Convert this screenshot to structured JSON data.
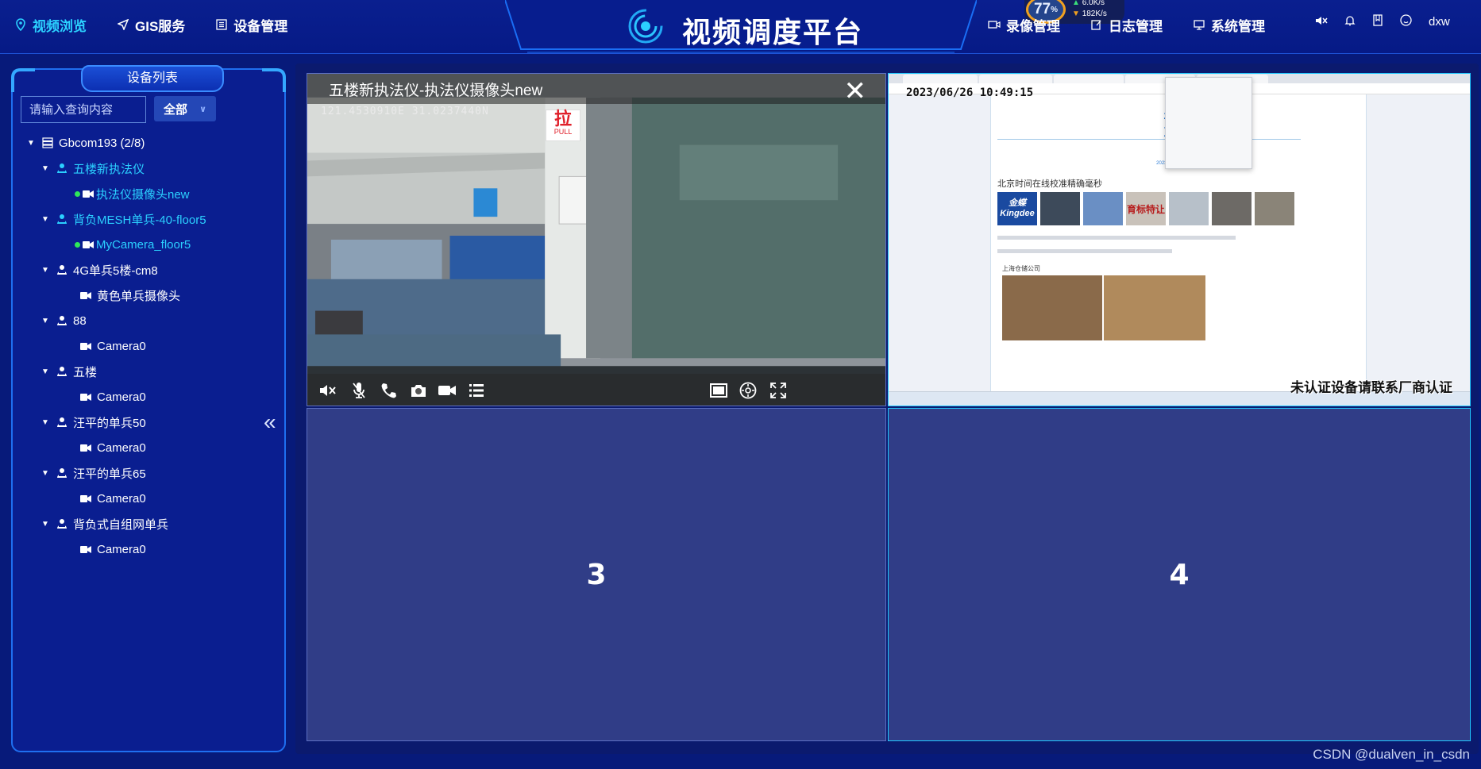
{
  "header": {
    "title": "视频调度平台",
    "nav_left": [
      {
        "label": "视频浏览",
        "icon": "location-pin-icon",
        "active": true
      },
      {
        "label": "GIS服务",
        "icon": "navigation-arrow-icon",
        "active": false
      },
      {
        "label": "设备管理",
        "icon": "list-icon",
        "active": false
      }
    ],
    "nav_right": [
      {
        "label": "录像管理",
        "icon": "video-camera-icon"
      },
      {
        "label": "日志管理",
        "icon": "document-edit-icon"
      },
      {
        "label": "系统管理",
        "icon": "monitor-icon"
      }
    ],
    "username": "dxw",
    "net_meter": {
      "percent": "77",
      "percent_unit": "%",
      "upload": "6.0K/s",
      "download": "182K/s"
    }
  },
  "sidebar": {
    "title": "设备列表",
    "search_placeholder": "请输入查询内容",
    "filter_value": "全部",
    "tree": [
      {
        "label": "Gbcom193 (2/8)",
        "level": 0,
        "type": "server",
        "expanded": true
      },
      {
        "label": "五楼新执法仪",
        "level": 1,
        "type": "device-online",
        "expanded": true,
        "selected": true
      },
      {
        "label": "执法仪摄像头new",
        "level": 2,
        "type": "camera",
        "online": true,
        "selected": true
      },
      {
        "label": "背负MESH单兵-40-floor5",
        "level": 1,
        "type": "device-online",
        "expanded": true,
        "selected": true
      },
      {
        "label": "MyCamera_floor5",
        "level": 2,
        "type": "camera",
        "online": true,
        "selected": true
      },
      {
        "label": "4G单兵5楼-cm8",
        "level": 1,
        "type": "device",
        "expanded": true
      },
      {
        "label": "黄色单兵摄像头",
        "level": 2,
        "type": "camera"
      },
      {
        "label": "88",
        "level": 1,
        "type": "device",
        "expanded": true
      },
      {
        "label": "Camera0",
        "level": 2,
        "type": "camera"
      },
      {
        "label": "五楼",
        "level": 1,
        "type": "device",
        "expanded": true
      },
      {
        "label": "Camera0",
        "level": 2,
        "type": "camera"
      },
      {
        "label": "汪平的单兵50",
        "level": 1,
        "type": "device",
        "expanded": true
      },
      {
        "label": "Camera0",
        "level": 2,
        "type": "camera"
      },
      {
        "label": "汪平的单兵65",
        "level": 1,
        "type": "device",
        "expanded": true
      },
      {
        "label": "Camera0",
        "level": 2,
        "type": "camera"
      },
      {
        "label": "背负式自组网单兵",
        "level": 1,
        "type": "device",
        "expanded": true
      },
      {
        "label": "Camera0",
        "level": 2,
        "type": "camera"
      }
    ],
    "collapse_glyph": "«"
  },
  "video": {
    "cell1": {
      "title": "五楼新执法仪-执法仪摄像头new",
      "coords": "121.4530910E 31.0237440N",
      "close_glyph": "✕",
      "sign_text": "拉",
      "sign_sub": "PULL"
    },
    "cell2": {
      "timestamp": "2023/06/26 10:49:15",
      "page_header": "北京",
      "page_date": "2023-0",
      "page_time": "10:4",
      "page_footer_date": "2023-06-26 10:49:15",
      "page_heading": "北京时间在线校准精确毫秒",
      "thumb_brand": "Kingdee",
      "thumb_brand_cn": "金蝶",
      "thumb_sign": "育标特让",
      "company": "上海仓储公司",
      "notice": "未认证设备请联系厂商认证"
    },
    "cell3": {
      "label": "3"
    },
    "cell4": {
      "label": "4"
    }
  },
  "watermark": "CSDN @dualven_in_csdn"
}
